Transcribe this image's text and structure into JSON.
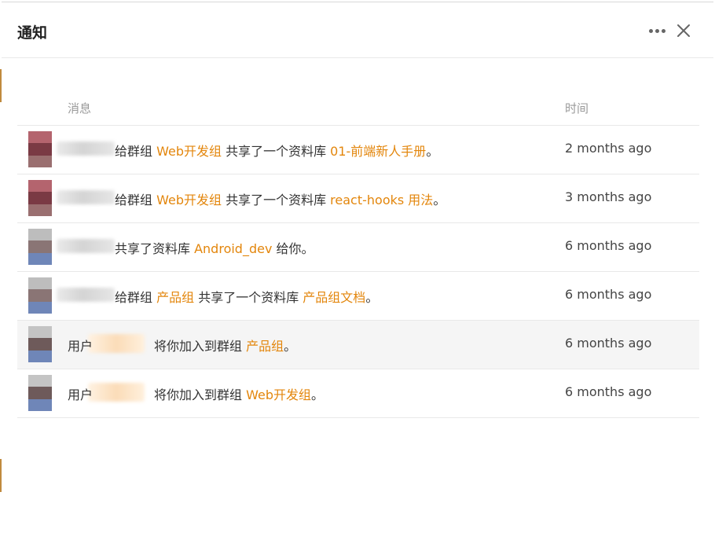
{
  "header": {
    "title": "通知"
  },
  "table": {
    "col_message": "消息",
    "col_time": "时间",
    "rows": [
      {
        "prefix": "给群组 ",
        "group": "Web开发组",
        "mid": " 共享了一个资料库 ",
        "library": "01-前端新人手册",
        "suffix": "。",
        "time": "2 months ago"
      },
      {
        "prefix": "给群组 ",
        "group": "Web开发组",
        "mid": " 共享了一个资料库 ",
        "library": "react-hooks 用法",
        "suffix": "。",
        "time": "3 months ago"
      },
      {
        "prefix": "共享了资料库 ",
        "library": "Android_dev",
        "suffix": " 给你。",
        "time": "6 months ago"
      },
      {
        "prefix": "给群组 ",
        "group": "产品组",
        "mid": " 共享了一个资料库 ",
        "library": "产品组文档",
        "suffix": "。",
        "time": "6 months ago"
      },
      {
        "prefix": "用户",
        "mid": "将你加入到群组 ",
        "group": "产品组",
        "suffix": "。",
        "time": "6 months ago"
      },
      {
        "prefix": "用户",
        "mid": "将你加入到群组 ",
        "group": "Web开发组",
        "suffix": "。",
        "time": "6 months ago"
      }
    ]
  },
  "colors": {
    "link": "#e3860c",
    "row_highlight": "#f5f5f5",
    "border": "#e8e8e8"
  },
  "icons": {
    "more": "more-horizontal-icon",
    "close": "close-icon"
  }
}
